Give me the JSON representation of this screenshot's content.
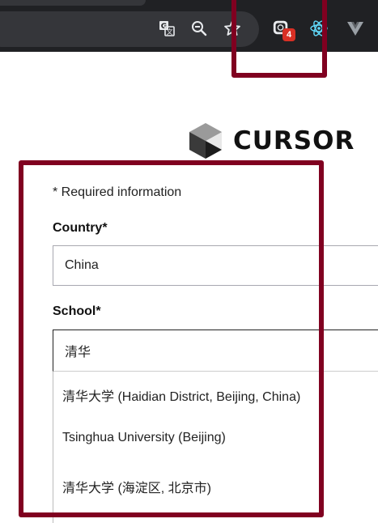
{
  "browser": {
    "toolbar_icons": [
      "translate-icon",
      "zoom-out-icon",
      "bookmark-star-icon",
      "extension-icon",
      "react-devtools-icon",
      "vue-devtools-icon"
    ],
    "extension_badge": "4",
    "badge_color": "#d93025"
  },
  "highlight_color": "#800020",
  "logo": {
    "text": "CURSOR"
  },
  "form": {
    "required_note": "* Required information",
    "country": {
      "label": "Country*",
      "value": "China"
    },
    "school": {
      "label": "School*",
      "value": "清华"
    },
    "suggestions": [
      "清华大学 (Haidian District, Beijing, China)",
      "Tsinghua University (Beijing)",
      "清华大学 (海淀区, 北京市)"
    ]
  }
}
